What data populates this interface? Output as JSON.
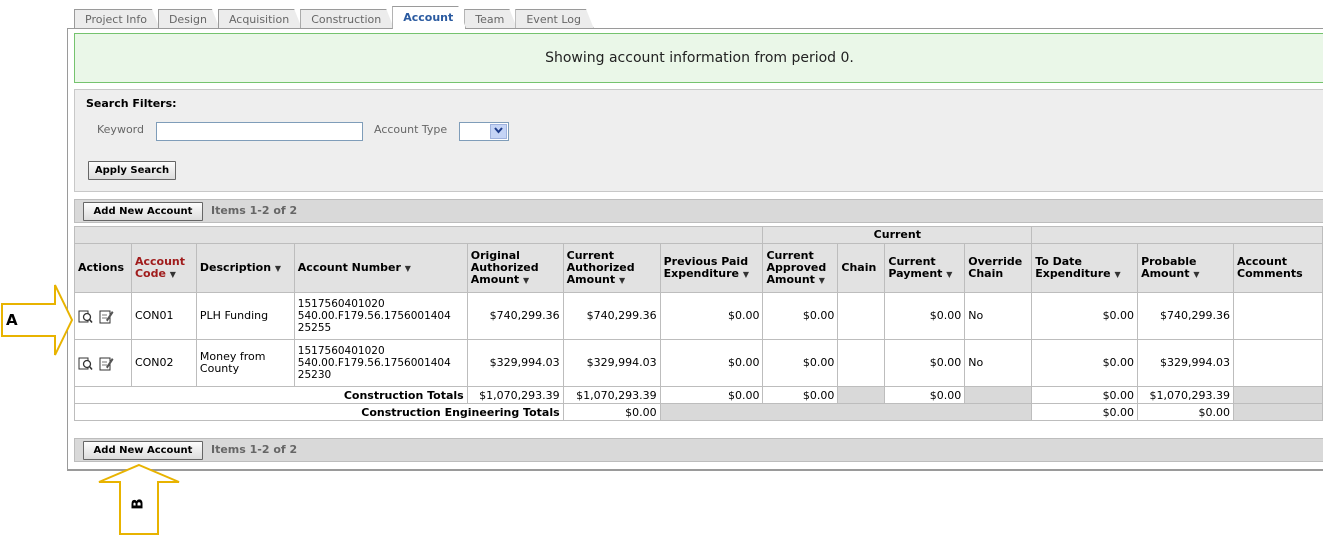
{
  "tabs": [
    "Project Info",
    "Design",
    "Acquisition",
    "Construction",
    "Account",
    "Team",
    "Event Log"
  ],
  "active_tab": "Account",
  "info_message": "Showing account information from period 0.",
  "search": {
    "title": "Search Filters:",
    "keyword_label": "Keyword",
    "keyword_value": "",
    "account_type_label": "Account Type",
    "account_type_value": "",
    "apply_label": "Apply Search"
  },
  "toolbar": {
    "add_label": "Add New Account",
    "items_text": "Items 1-2 of 2"
  },
  "table": {
    "group_header": "Current",
    "headers": {
      "actions": "Actions",
      "account_code": "Account Code",
      "description": "Description",
      "account_number": "Account Number",
      "original_authorized": "Original Authorized Amount",
      "current_authorized": "Current Authorized Amount",
      "previous_paid": "Previous Paid Expenditure",
      "current_approved": "Current Approved Amount",
      "chain": "Chain",
      "current_payment": "Current Payment",
      "override_chain": "Override Chain",
      "to_date": "To Date Expenditure",
      "probable": "Probable Amount",
      "comments": "Account Comments"
    },
    "sort_arrow": "▼",
    "rows": [
      {
        "code": "CON01",
        "description": "PLH Funding",
        "account_number": "1517560401020 540.00.F179.56.1756001404 25255",
        "original_authorized": "$740,299.36",
        "current_authorized": "$740,299.36",
        "previous_paid": "$0.00",
        "current_approved": "$0.00",
        "chain": "",
        "current_payment": "$0.00",
        "override_chain": "No",
        "to_date": "$0.00",
        "probable": "$740,299.36",
        "comments": ""
      },
      {
        "code": "CON02",
        "description": "Money from County",
        "account_number": "1517560401020 540.00.F179.56.1756001404 25230",
        "original_authorized": "$329,994.03",
        "current_authorized": "$329,994.03",
        "previous_paid": "$0.00",
        "current_approved": "$0.00",
        "chain": "",
        "current_payment": "$0.00",
        "override_chain": "No",
        "to_date": "$0.00",
        "probable": "$329,994.03",
        "comments": ""
      }
    ],
    "construction_totals": {
      "label": "Construction Totals",
      "original_authorized": "$1,070,293.39",
      "current_authorized": "$1,070,293.39",
      "previous_paid": "$0.00",
      "current_approved": "$0.00",
      "current_payment": "$0.00",
      "to_date": "$0.00",
      "probable": "$1,070,293.39"
    },
    "engineering_totals": {
      "label": "Construction Engineering Totals",
      "current_authorized": "$0.00",
      "to_date": "$0.00",
      "probable": "$0.00"
    }
  },
  "callouts": {
    "a": "A",
    "b": "B"
  },
  "icons": [
    "view-details-icon",
    "edit-icon",
    "dropdown-arrow-icon"
  ],
  "colors": {
    "info_bg": "#eaf7e8",
    "info_border": "#75c36e",
    "header_red": "#a01c1c",
    "active_tab": "#2a5aa0"
  }
}
